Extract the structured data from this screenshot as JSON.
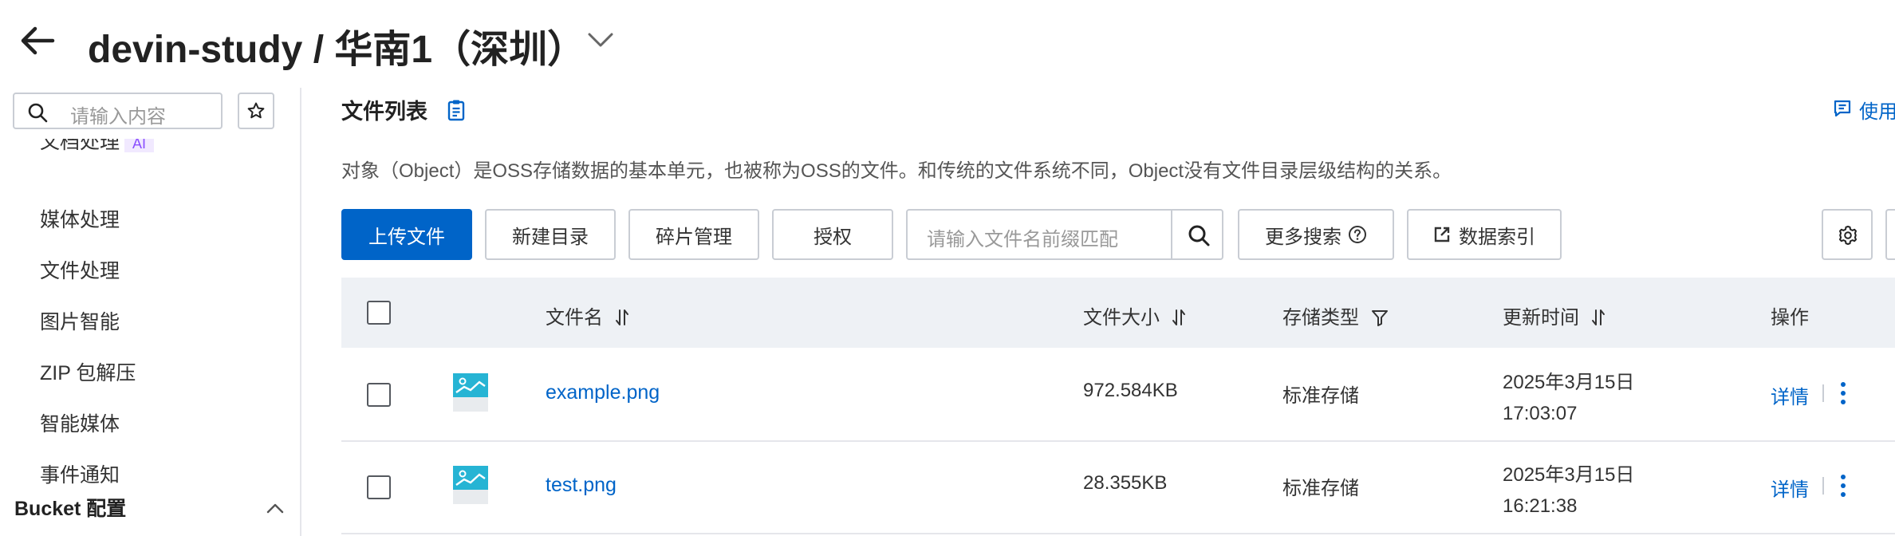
{
  "header": {
    "title": "devin-study / 华南1（深圳）",
    "icons": {
      "back": "arrow-left-icon",
      "dropdown": "chevron-down-icon"
    }
  },
  "sidebar": {
    "search_placeholder": "请输入内容",
    "partial_item": "文档处理",
    "ai_badge": "AI",
    "items": [
      {
        "label": "媒体处理"
      },
      {
        "label": "文件处理"
      },
      {
        "label": "图片智能"
      },
      {
        "label": "ZIP 包解压"
      },
      {
        "label": "智能媒体"
      },
      {
        "label": "事件通知"
      }
    ],
    "group_label": "Bucket 配置"
  },
  "main": {
    "section_title": "文件列表",
    "usage_link": "使用",
    "description": "对象（Object）是OSS存储数据的基本单元，也被称为OSS的文件。和传统的文件系统不同，Object没有文件目录层级结构的关系。",
    "toolbar": {
      "upload": "上传文件",
      "new_dir": "新建目录",
      "fragments": "碎片管理",
      "authorize": "授权",
      "search_placeholder": "请输入文件名前缀匹配",
      "more_search": "更多搜索",
      "data_index": "数据索引"
    },
    "table": {
      "headers": {
        "name": "文件名",
        "size": "文件大小",
        "storage": "存储类型",
        "updated": "更新时间",
        "actions": "操作"
      },
      "rows": [
        {
          "name": "example.png",
          "size": "972.584KB",
          "storage": "标准存储",
          "date": "2025年3月15日",
          "time": "17:03:07",
          "action": "详情"
        },
        {
          "name": "test.png",
          "size": "28.355KB",
          "storage": "标准存储",
          "date": "2025年3月15日",
          "time": "16:21:38",
          "action": "详情"
        }
      ]
    }
  },
  "colors": {
    "accent": "#0064c8",
    "header_bg": "#eef1f5",
    "thumb": "#26b4d4"
  }
}
